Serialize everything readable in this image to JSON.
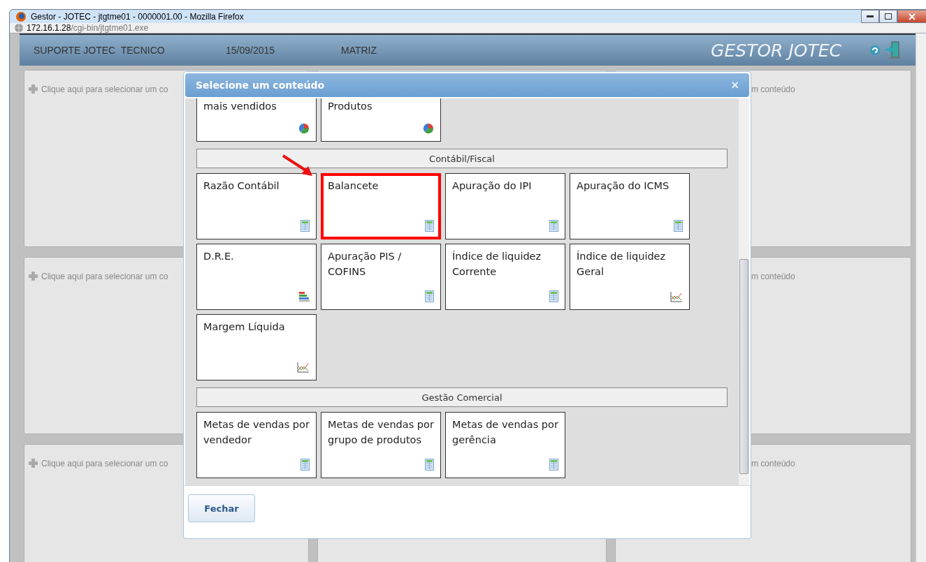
{
  "window": {
    "title": "Gestor - JOTEC - jtgtme01 - 0000001.00 - Mozilla Firefox"
  },
  "address_bar": {
    "host": "172.16.1.28",
    "path": "/cgi-bin/jtgtme01.exe"
  },
  "app_header": {
    "user": "SUPORTE JOTEC  TECNICO",
    "date": "15/09/2015",
    "branch": "MATRIZ",
    "logo": "GESTOR JOTEC"
  },
  "panels": [
    {
      "left_text": "Clique aqui para selecionar um co",
      "right_text": "m conteúdo"
    },
    {
      "left_text": "Clique aqui para selecionar um co",
      "right_text": "m conteúdo"
    },
    {
      "left_text": "Clique aqui para selecionar um co",
      "right_text": "m conteúdo"
    }
  ],
  "dialog": {
    "title": "Selecione um conteúdo",
    "close_label": "×",
    "button": "Fechar",
    "sections": [
      {
        "tiles": [
          {
            "label": "mais vendidos",
            "kind": "pie",
            "highlighted": false
          },
          {
            "label": "Produtos",
            "kind": "pie",
            "highlighted": false
          }
        ]
      },
      {
        "title": "Contábil/Fiscal",
        "tiles": [
          {
            "label": "Razão Contábil",
            "kind": "sheet",
            "highlighted": false
          },
          {
            "label": "Balancete",
            "kind": "sheet",
            "highlighted": true
          },
          {
            "label": "Apuração do IPI",
            "kind": "sheet",
            "highlighted": false
          },
          {
            "label": "Apuração do ICMS",
            "kind": "sheet",
            "highlighted": false
          },
          {
            "label": "D.R.E.",
            "kind": "bars",
            "highlighted": false
          },
          {
            "label": "Apuração PIS / COFINS",
            "kind": "sheet",
            "highlighted": false
          },
          {
            "label": "Índice de liquidez Corrente",
            "kind": "sheet",
            "highlighted": false
          },
          {
            "label": "Índice de liquidez Geral",
            "kind": "line",
            "highlighted": false
          },
          {
            "label": "Margem Líquida",
            "kind": "line",
            "highlighted": false
          }
        ]
      },
      {
        "title": "Gestão Comercial",
        "tiles": [
          {
            "label": "Metas de vendas por vendedor",
            "kind": "sheet",
            "highlighted": false
          },
          {
            "label": "Metas de vendas por grupo de produtos",
            "kind": "sheet",
            "highlighted": false
          },
          {
            "label": "Metas de vendas por gerência",
            "kind": "sheet",
            "highlighted": false
          }
        ]
      }
    ]
  }
}
